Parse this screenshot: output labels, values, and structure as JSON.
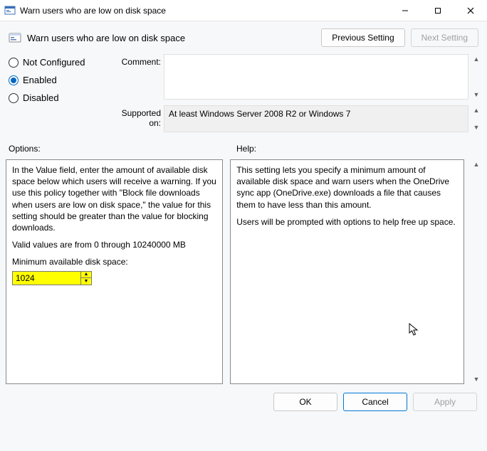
{
  "window": {
    "title": "Warn users who are low on disk space"
  },
  "header": {
    "title": "Warn users who are low on disk space",
    "prev_setting": "Previous Setting",
    "next_setting": "Next Setting"
  },
  "radios": {
    "not_configured": "Not Configured",
    "enabled": "Enabled",
    "disabled": "Disabled",
    "selected": "enabled"
  },
  "labels": {
    "comment": "Comment:",
    "supported_on": "Supported on:",
    "options": "Options:",
    "help": "Help:"
  },
  "supported_on_text": "At least Windows Server 2008 R2 or Windows 7",
  "options_panel": {
    "para1": "In the Value field, enter the amount of available disk space below which users will receive a warning. If you use this policy together with \"Block file downloads when users are low on disk space,\" the value for this setting should be greater than the value for blocking downloads.",
    "para2": "Valid values are from 0 through 10240000 MB",
    "field_label": "Minimum available disk space:",
    "value": "1024"
  },
  "help_panel": {
    "para1": "This setting lets you specify a minimum amount of available disk space and warn users when the OneDrive sync app (OneDrive.exe) downloads a file that causes them to have less than this amount.",
    "para2": "Users will be prompted with options to help free up space."
  },
  "footer": {
    "ok": "OK",
    "cancel": "Cancel",
    "apply": "Apply"
  }
}
